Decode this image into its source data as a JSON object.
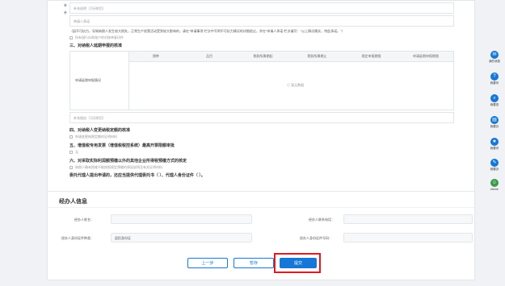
{
  "form": {
    "top_label_1": "补充说明（可另附页）",
    "top_label_2": "补",
    "top_label_3": "补",
    "agent_opinion_label": "审请人承诺",
    "notice_text": "（因不可抗力，导致纳税人发生较大损失，正常生产经营活动受到较大影响的，请在\"申请事项\"栏次中写明不可抗力情况的详细经过，并在\"申请人承诺\"栏次填写：\"以上情况属实，特此承诺。\"）",
    "checkbox_1": "所有银行存款账户的对账单复印件",
    "section_3": "三、对纳税人延期申报的核准",
    "table_headers": [
      "税种",
      "品目",
      "税款所属期起",
      "税款所属期止",
      "规定申报期限",
      "申请延期申报期限"
    ],
    "table_row_label": "申请延期申报情况",
    "empty_text": "暂无数据",
    "supplement_label": "补充理由（可另附页）",
    "section_4": "四、对纳税人变更纳税定额的核准",
    "checkbox_4": "申请变更纳税定额的证明材料",
    "section_5": "五、增值税专用发票（增值税税控系统）最高开票限额审批",
    "checkbox_5": "无",
    "section_6": "六、对采取实际利润额预缴以外的其他企业所得税预缴方式的核定",
    "checkbox_6": "纳税人确有困难不能按照规定预缴的原因说明及有关证明材料",
    "trust_text": "委托代理人提出申请的，还应当提供代理委托书（ ）、代理人身份证件（ ）。"
  },
  "agent": {
    "title": "经办人信息",
    "name_label": "经办人姓名：",
    "phone_label": "经办人联系电话：",
    "id_type_label": "经办人身份证件种类：",
    "id_type_value": "居民身份证",
    "id_no_label": "经办人身份证件号码："
  },
  "buttons": {
    "prev": "上一步",
    "save": "暂存",
    "submit": "提交"
  },
  "sidebar": [
    {
      "label": "我的消息",
      "icon": "message-icon",
      "glyph": "✉"
    },
    {
      "label": "我要问",
      "icon": "question-icon",
      "glyph": "?"
    },
    {
      "label": "我要查",
      "icon": "search-icon",
      "glyph": "⌕"
    },
    {
      "label": "我要办",
      "icon": "task-icon",
      "glyph": "▤"
    },
    {
      "label": "我要评",
      "icon": "rate-icon",
      "glyph": "★"
    },
    {
      "label": "我要办",
      "icon": "edit-icon",
      "glyph": "✎"
    },
    {
      "label": "ethme",
      "icon": "robot-icon",
      "glyph": "☺"
    }
  ],
  "colors": {
    "primary": "#1677d6",
    "highlight": "#e0191f"
  }
}
